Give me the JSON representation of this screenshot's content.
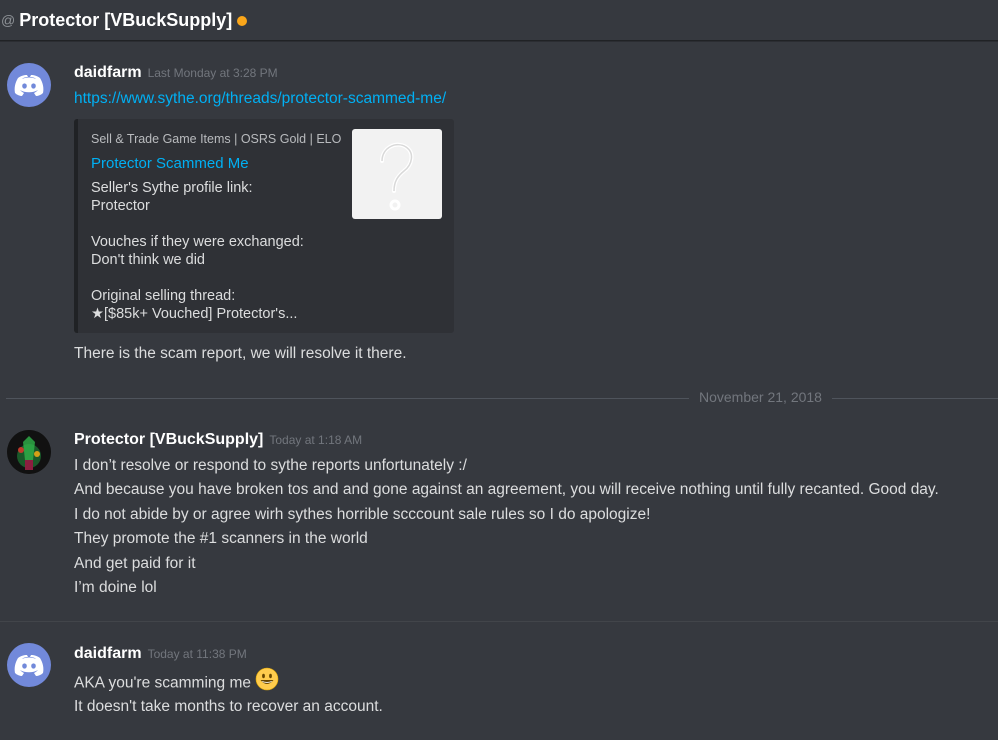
{
  "header": {
    "at_symbol": "@",
    "title": "Protector [VBuckSupply]",
    "status_color": "#faa61a"
  },
  "messages": [
    {
      "author": "daidfarm",
      "timestamp": "Last Monday at 3:28 PM",
      "avatar": "discord-logo-icon",
      "link": "https://www.sythe.org/threads/protector-scammed-me/",
      "embed": {
        "provider": "Sell & Trade Game Items | OSRS Gold | ELO",
        "title": "Protector Scammed Me",
        "description": [
          "Seller's Sythe profile link:",
          "Protector",
          "",
          "Vouches if they were exchanged:",
          "Don't think we did",
          "",
          "Original selling thread:",
          "★[$85k+ Vouched] Protector's..."
        ],
        "thumbnail": "question-mark-icon"
      },
      "text": "There is the scam report, we will resolve it there."
    },
    {
      "author": "Protector [VBuckSupply]",
      "timestamp": "Today at 1:18 AM",
      "avatar": "user-photo-avatar",
      "lines": [
        "I don’t resolve or respond to sythe reports unfortunately :/",
        "And because you have broken tos and and gone against an agreement, you will receive nothing until fully recanted. Good day.",
        "I do not abide by or agree wirh  sythes horrible scccount sale rules so I do apologize!",
        "They promote the #1 scanners in the world",
        "And get paid for it",
        "I’m doine lol"
      ]
    },
    {
      "author": "daidfarm",
      "timestamp": "Today at 11:38 PM",
      "avatar": "discord-logo-icon",
      "lines": [
        "AKA you're scamming me",
        "It doesn't take months to recover an account."
      ],
      "emoji": "smiley-emoji-icon"
    }
  ],
  "date_separator": "November 21, 2018",
  "colors": {
    "background": "#36393f",
    "link": "#00b0f4",
    "embed_bg": "#2f3136",
    "blurple": "#7289da"
  }
}
